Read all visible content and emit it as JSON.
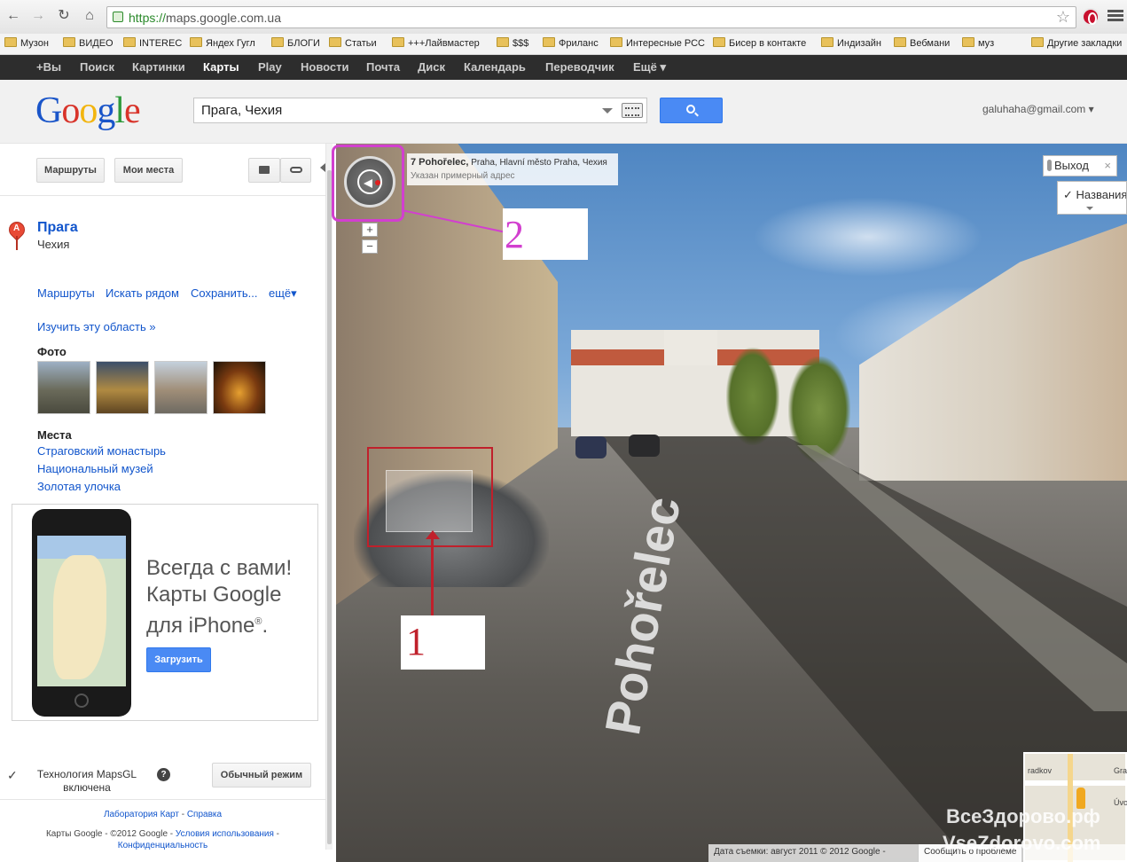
{
  "browser": {
    "url_scheme": "https://",
    "url_host": "maps.google.com.ua",
    "bookmarks": [
      "Музон",
      "ВИДЕО",
      "INTEREC",
      "Яндех Гугл",
      "БЛОГИ",
      "Статьи",
      "+++Лайвмастер",
      "$$$",
      "Фриланс",
      "Интересные РСС",
      "Бисер в контакте",
      "Индизайн",
      "Вебмани",
      "муз"
    ],
    "other_bookmarks": "Другие закладки"
  },
  "gbar": {
    "items": [
      "+Вы",
      "Поиск",
      "Картинки",
      "Карты",
      "Play",
      "Новости",
      "Почта",
      "Диск",
      "Календарь",
      "Переводчик",
      "Ещё ▾"
    ],
    "active": "Карты"
  },
  "header": {
    "logo": [
      "G",
      "o",
      "o",
      "g",
      "l",
      "e"
    ],
    "logo_colors": [
      "#1a55c9",
      "#d8342b",
      "#f2b50f",
      "#1a55c9",
      "#2e9a3b",
      "#d8342b"
    ],
    "search_value": "Прага, Чехия",
    "account": "galuhaha@gmail.com ▾"
  },
  "panel": {
    "routes_button": "Маршруты",
    "my_places_button": "Мои места",
    "place_name": "Прага",
    "place_country": "Чехия",
    "pin_letter": "A",
    "actions": [
      "Маршруты",
      "Искать рядом",
      "Сохранить...",
      "ещё▾"
    ],
    "explore_link": "Изучить эту область »",
    "photos_label": "Фото",
    "places_label": "Места",
    "places": [
      "Страговский монастырь",
      "Национальный музей",
      "Золотая улочка"
    ],
    "promo_text_1": "Всегда с вами!",
    "promo_text_2": "Карты Google",
    "promo_text_3": "для iPhone",
    "promo_reg": "®",
    "promo_period": ".",
    "promo_button": "Загрузить",
    "mapsgl_text_1": "Технология MapsGL",
    "mapsgl_text_2": "включена",
    "normal_mode_button": "Обычный режим",
    "footer_lab": "Лаборатория Карт",
    "footer_help": "Справка",
    "footer_copy": "Карты Google - ©2012 Google - ",
    "footer_terms": "Условия использования",
    "footer_privacy": "Конфиденциальность"
  },
  "streetview": {
    "address_title": "7 Pohořelec,",
    "address_rest": " Praha, Hlavní město Praha, Чехия",
    "address_note": "Указан примерный адрес",
    "exit_button": "Выход",
    "names_button": "Названия",
    "street_name": "Pohořelec",
    "data_text": "Дата съемки: август 2011 © 2012 Google -",
    "report_link": "Сообщить о проблеме",
    "minimap_label_1": "radkov",
    "minimap_label_2": "Gra",
    "minimap_label_3": "Úvo",
    "watermark_1": "ВсеЗдорово.рф",
    "watermark_2": "VseZdorovo.com"
  },
  "annotations": {
    "label_1": "1",
    "label_2": "2"
  },
  "colors": {
    "accent_blue": "#4a8af4",
    "annotation_red": "#c0202b",
    "annotation_magenta": "#d23fcf",
    "gbar_bg": "#2d2d2d"
  }
}
